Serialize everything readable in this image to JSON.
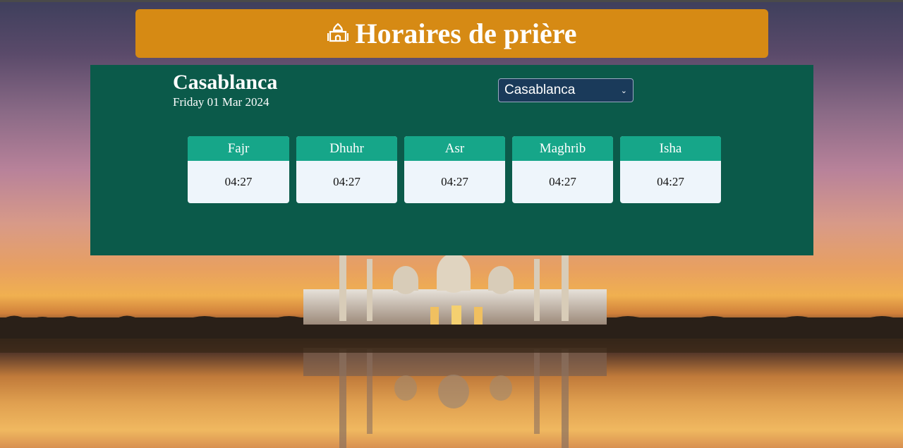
{
  "header": {
    "title": "Horaires de prière",
    "icon": "mosque-icon"
  },
  "location": {
    "city": "Casablanca",
    "date": "Friday 01 Mar 2024"
  },
  "city_select": {
    "selected": "Casablanca"
  },
  "prayers": [
    {
      "name": "Fajr",
      "time": "04:27"
    },
    {
      "name": "Dhuhr",
      "time": "04:27"
    },
    {
      "name": "Asr",
      "time": "04:27"
    },
    {
      "name": "Maghrib",
      "time": "04:27"
    },
    {
      "name": "Isha",
      "time": "04:27"
    }
  ],
  "colors": {
    "title_bar": "#d68a14",
    "panel": "#0b5a4a",
    "card_header": "#16a689",
    "card_body": "#eef5fb",
    "select_bg": "#1a3a5a"
  }
}
